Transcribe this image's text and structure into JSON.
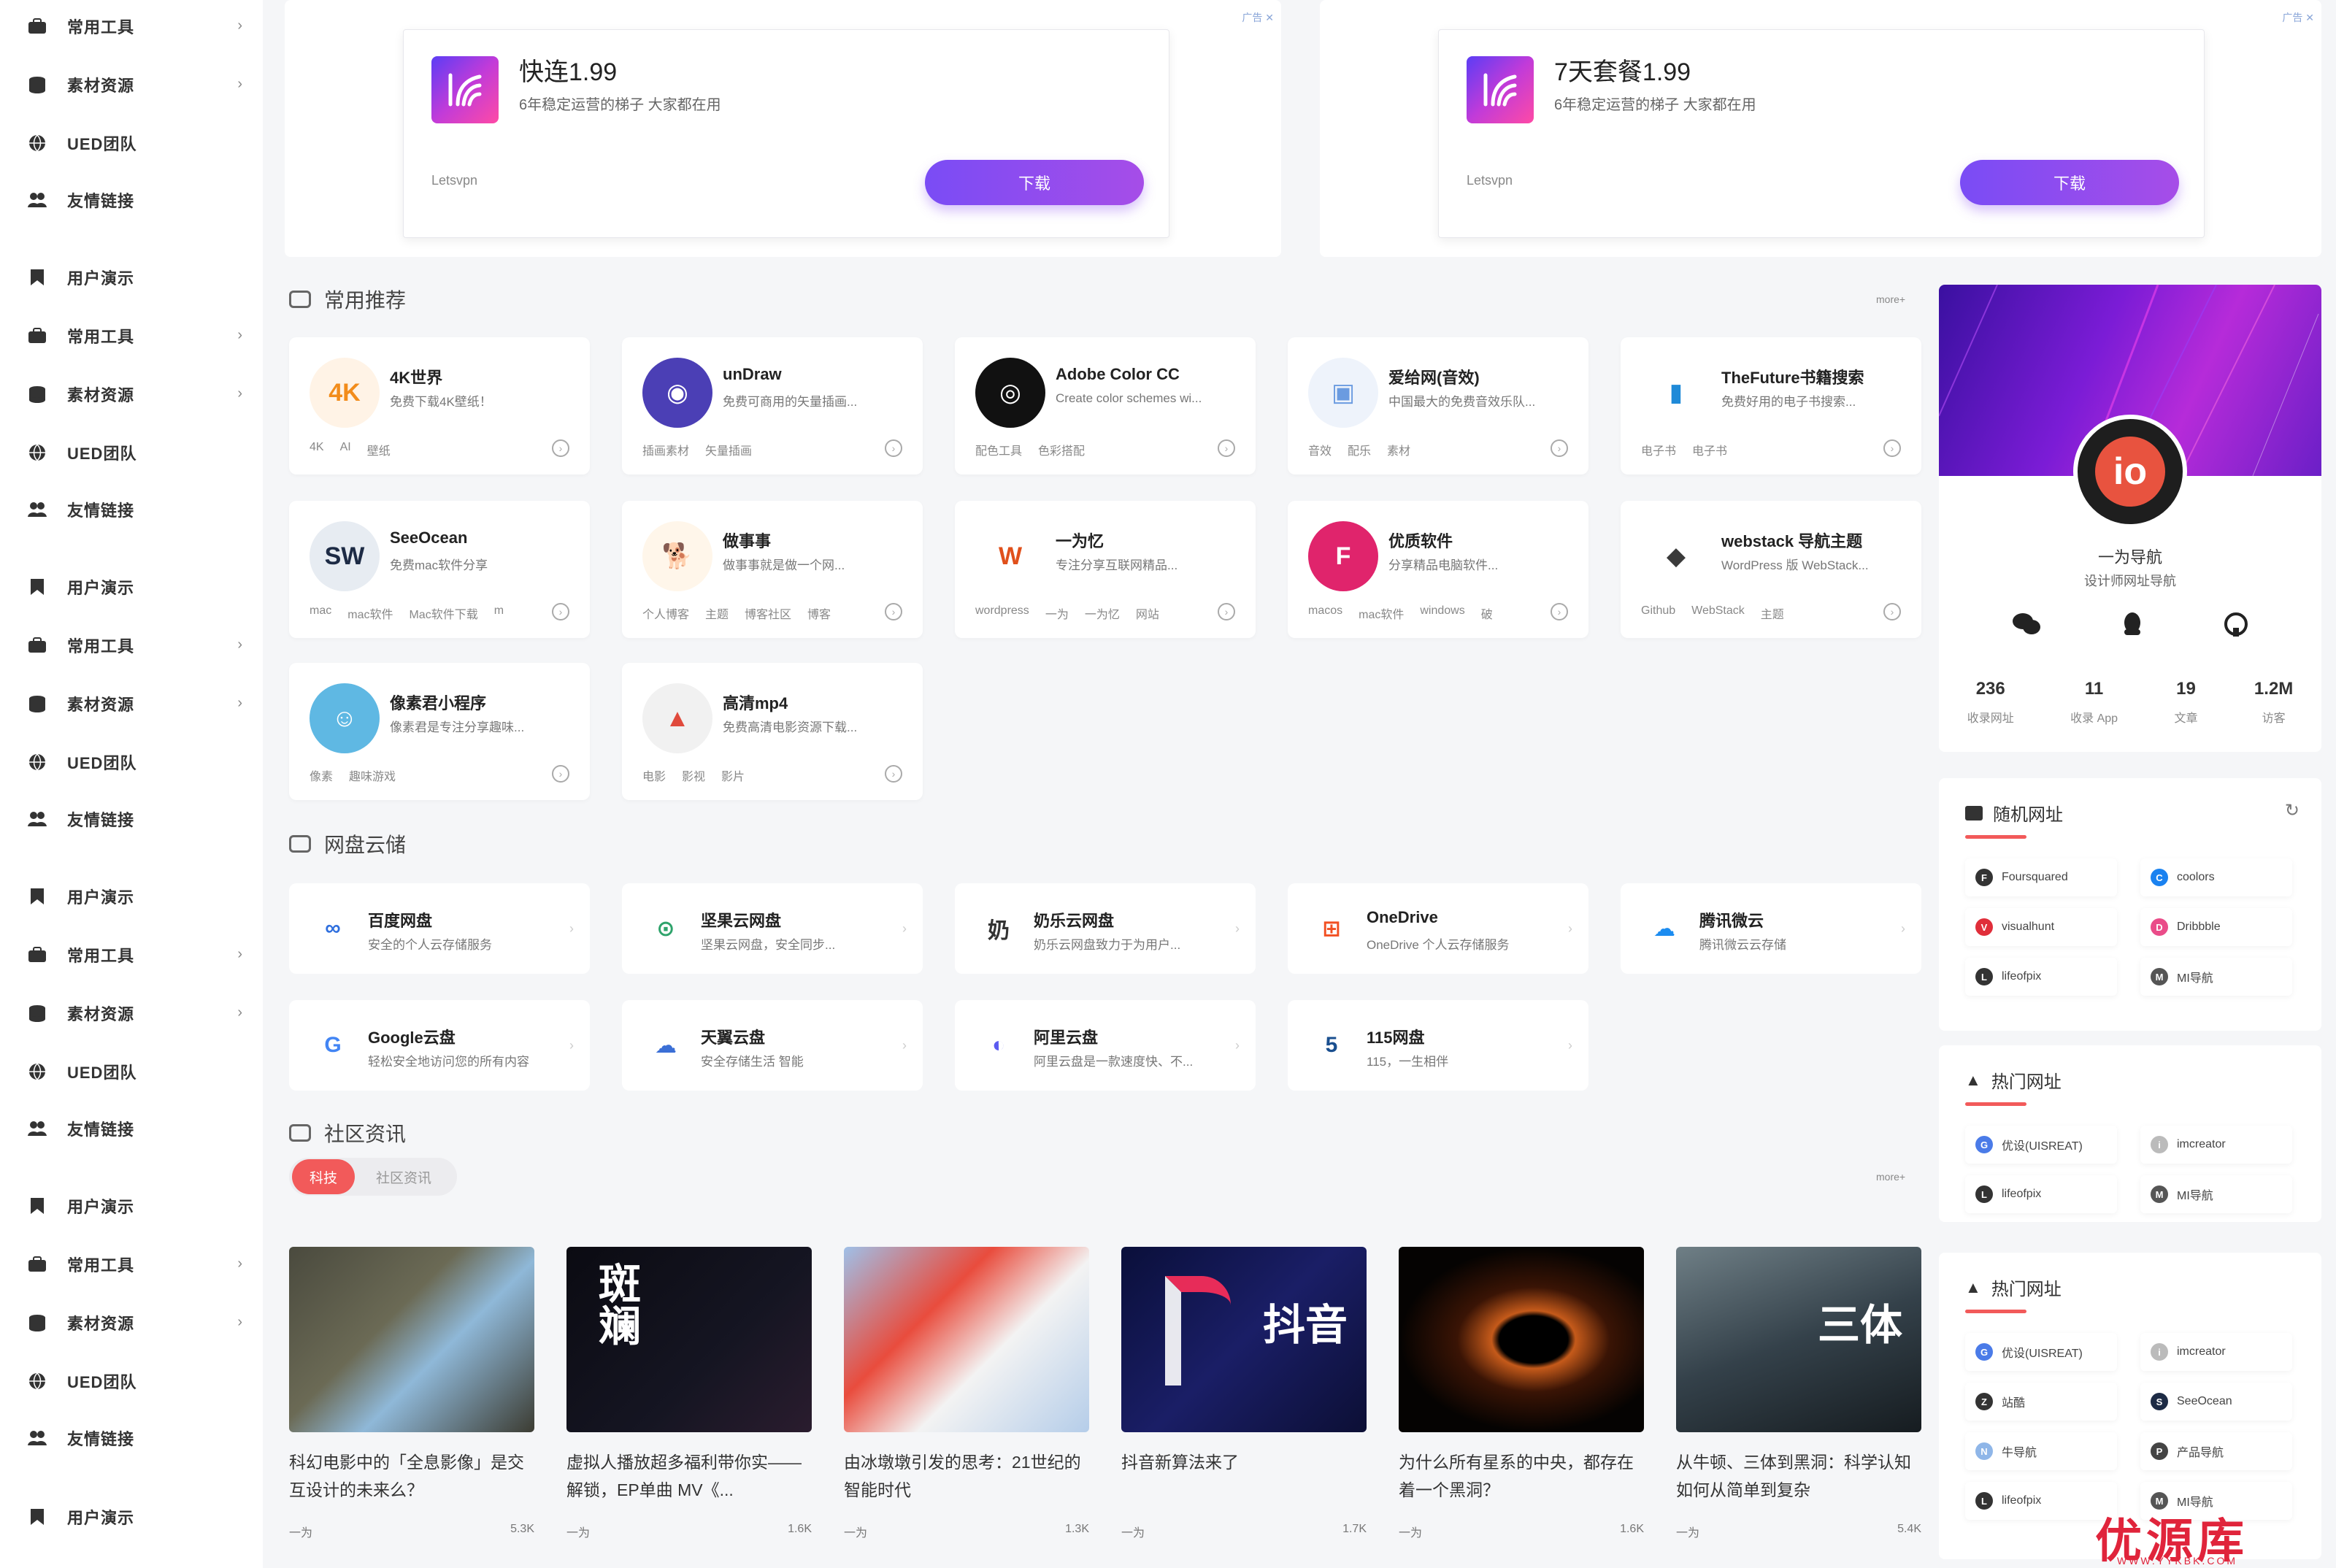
{
  "sidebar": {
    "items": [
      {
        "label": "常用工具",
        "icon": "briefcase-icon",
        "chevron": "›"
      },
      {
        "label": "素材资源",
        "icon": "database-icon",
        "chevron": "›"
      },
      {
        "label": "UED团队",
        "icon": "globe-icon",
        "chevron": ""
      },
      {
        "label": "友情链接",
        "icon": "users-icon",
        "chevron": ""
      },
      {
        "label": "用户演示",
        "icon": "bookmark-icon",
        "chevron": ""
      },
      {
        "label": "常用工具",
        "icon": "briefcase-icon",
        "chevron": "›"
      },
      {
        "label": "素材资源",
        "icon": "database-icon",
        "chevron": "›"
      },
      {
        "label": "UED团队",
        "icon": "globe-icon",
        "chevron": ""
      },
      {
        "label": "友情链接",
        "icon": "users-icon",
        "chevron": ""
      },
      {
        "label": "用户演示",
        "icon": "bookmark-icon",
        "chevron": ""
      },
      {
        "label": "常用工具",
        "icon": "briefcase-icon",
        "chevron": "›"
      },
      {
        "label": "素材资源",
        "icon": "database-icon",
        "chevron": "›"
      },
      {
        "label": "UED团队",
        "icon": "globe-icon",
        "chevron": ""
      },
      {
        "label": "友情链接",
        "icon": "users-icon",
        "chevron": ""
      },
      {
        "label": "用户演示",
        "icon": "bookmark-icon",
        "chevron": ""
      },
      {
        "label": "常用工具",
        "icon": "briefcase-icon",
        "chevron": "›"
      },
      {
        "label": "素材资源",
        "icon": "database-icon",
        "chevron": "›"
      },
      {
        "label": "UED团队",
        "icon": "globe-icon",
        "chevron": ""
      },
      {
        "label": "友情链接",
        "icon": "users-icon",
        "chevron": ""
      },
      {
        "label": "用户演示",
        "icon": "bookmark-icon",
        "chevron": ""
      },
      {
        "label": "常用工具",
        "icon": "briefcase-icon",
        "chevron": "›"
      },
      {
        "label": "素材资源",
        "icon": "database-icon",
        "chevron": "›"
      },
      {
        "label": "UED团队",
        "icon": "globe-icon",
        "chevron": ""
      },
      {
        "label": "友情链接",
        "icon": "users-icon",
        "chevron": ""
      },
      {
        "label": "用户演示",
        "icon": "bookmark-icon",
        "chevron": ""
      }
    ]
  },
  "ads": [
    {
      "title": "快连1.99",
      "desc": "6年稳定运营的梯子 大家都在用",
      "brand": "Letsvpn",
      "button": "下载",
      "mark": "广告 ✕"
    },
    {
      "title": "7天套餐1.99",
      "desc": "6年稳定运营的梯子 大家都在用",
      "brand": "Letsvpn",
      "button": "下载",
      "mark": "广告 ✕"
    }
  ],
  "sections": {
    "recommend": {
      "title": "常用推荐",
      "more": "more+"
    },
    "cloud": {
      "title": "网盘云储"
    },
    "news": {
      "title": "社区资讯",
      "more": "more+"
    }
  },
  "recommend_sites": [
    {
      "name": "4K世界",
      "desc": "免费下载4K壁纸！",
      "tags": [
        "4K",
        "AI",
        "壁纸"
      ],
      "logo_text": "4K",
      "logo_bg": "#fff3e6",
      "logo_color": "#f28c1b"
    },
    {
      "name": "unDraw",
      "desc": "免费可商用的矢量插画...",
      "tags": [
        "插画素材",
        "矢量插画"
      ],
      "logo_text": "◉",
      "logo_bg": "#4b3fb5",
      "logo_color": "#ffffff"
    },
    {
      "name": "Adobe Color CC",
      "desc": "Create color schemes wi...",
      "tags": [
        "配色工具",
        "色彩搭配"
      ],
      "logo_text": "◎",
      "logo_bg": "#111111",
      "logo_color": "#ffffff"
    },
    {
      "name": "爱给网(音效)",
      "desc": "中国最大的免费音效乐队...",
      "tags": [
        "音效",
        "配乐",
        "素材"
      ],
      "logo_text": "▣",
      "logo_bg": "#eef3fb",
      "logo_color": "#6b9be0"
    },
    {
      "name": "TheFuture书籍搜索",
      "desc": "免费好用的电子书搜索...",
      "tags": [
        "电子书",
        "电子书"
      ],
      "logo_text": "▮",
      "logo_bg": "#ffffff",
      "logo_color": "#1f8ad8"
    },
    {
      "name": "SeeOcean",
      "desc": "免费mac软件分享",
      "tags": [
        "mac",
        "mac软件",
        "Mac软件下载",
        "m"
      ],
      "logo_text": "SW",
      "logo_bg": "#e7ecf2",
      "logo_color": "#1d2b45"
    },
    {
      "name": "做事事",
      "desc": "做事事就是做一个网...",
      "tags": [
        "个人博客",
        "主题",
        "博客社区",
        "博客"
      ],
      "logo_text": "🐕",
      "logo_bg": "#fff6ea",
      "logo_color": "#d98a26"
    },
    {
      "name": "一为忆",
      "desc": "专注分享互联网精品...",
      "tags": [
        "wordpress",
        "一为",
        "一为忆",
        "网站"
      ],
      "logo_text": "W",
      "logo_bg": "#ffffff",
      "logo_color": "#e0501b"
    },
    {
      "name": "优质软件",
      "desc": "分享精品电脑软件...",
      "tags": [
        "macos",
        "mac软件",
        "windows",
        "破"
      ],
      "logo_text": "F",
      "logo_bg": "#e0246c",
      "logo_color": "#ffffff"
    },
    {
      "name": "webstack 导航主题",
      "desc": "WordPress 版 WebStack...",
      "tags": [
        "Github",
        "WebStack",
        "主题"
      ],
      "logo_text": "◆",
      "logo_bg": "#ffffff",
      "logo_color": "#3a3a3a"
    },
    {
      "name": "像素君小程序",
      "desc": "像素君是专注分享趣味...",
      "tags": [
        "像素",
        "趣味游戏"
      ],
      "logo_text": "☺",
      "logo_bg": "#5fb8e3",
      "logo_color": "#ffffff"
    },
    {
      "name": "高清mp4",
      "desc": "免费高清电影资源下载...",
      "tags": [
        "电影",
        "影视",
        "影片"
      ],
      "logo_text": "▲",
      "logo_bg": "#f1f1f1",
      "logo_color": "#e04a3c"
    }
  ],
  "cloud_sites": [
    {
      "name": "百度网盘",
      "desc": "安全的个人云存储服务",
      "logo_text": "∞",
      "logo_color": "#2f6fde"
    },
    {
      "name": "坚果云网盘",
      "desc": "坚果云网盘，安全同步...",
      "logo_text": "⊙",
      "logo_color": "#2ea36b"
    },
    {
      "name": "奶乐云网盘",
      "desc": "奶乐云网盘致力于为用户...",
      "logo_text": "奶",
      "logo_color": "#333333"
    },
    {
      "name": "OneDrive",
      "desc": "OneDrive 个人云存储服务",
      "logo_text": "⊞",
      "logo_color": "#f25022"
    },
    {
      "name": "腾讯微云",
      "desc": "腾讯微云云存储",
      "logo_text": "☁",
      "logo_color": "#1c8cf0"
    },
    {
      "name": "Google云盘",
      "desc": "轻松安全地访问您的所有内容",
      "logo_text": "G",
      "logo_color": "#4285f4"
    },
    {
      "name": "天翼云盘",
      "desc": "安全存储生活 智能",
      "logo_text": "☁",
      "logo_color": "#3b6fd6"
    },
    {
      "name": "阿里云盘",
      "desc": "阿里云盘是一款速度快、不...",
      "logo_text": "◐",
      "logo_color": "#5b5bf0"
    },
    {
      "name": "115网盘",
      "desc": "115，一生相伴",
      "logo_text": "5",
      "logo_color": "#1a4f8f"
    }
  ],
  "news_tabs": [
    {
      "label": "科技",
      "active": true
    },
    {
      "label": "社区资讯",
      "active": false
    }
  ],
  "news": [
    {
      "title": "科幻电影中的「全息影像」是交互设计的未来么？",
      "author": "一为",
      "views": "5.3K"
    },
    {
      "title": "虚拟人播放超多福利带你实——解锁，EP单曲 MV《...",
      "author": "一为",
      "views": "1.6K"
    },
    {
      "title": "由冰墩墩引发的思考：21世纪的智能时代",
      "author": "一为",
      "views": "1.3K"
    },
    {
      "title": "抖音新算法来了",
      "author": "一为",
      "views": "1.7K"
    },
    {
      "title": "为什么所有星系的中央，都存在着一个黑洞？",
      "author": "一为",
      "views": "1.6K"
    },
    {
      "title": "从牛顿、三体到黑洞：科学认知如何从简单到复杂",
      "author": "一为",
      "views": "5.4K"
    }
  ],
  "news_images": [
    {
      "label": "",
      "palette": "hologram"
    },
    {
      "label": "斑斓",
      "palette": "dark"
    },
    {
      "label": "",
      "palette": "panda"
    },
    {
      "label": "抖音",
      "palette": "tiktok"
    },
    {
      "label": "",
      "palette": "blackhole"
    },
    {
      "label": "三体",
      "palette": "santi"
    }
  ],
  "profile": {
    "avatar_text": "io",
    "name": "一为导航",
    "sub": "设计师网址导航",
    "icons": [
      "wechat-icon",
      "qq-icon",
      "github-icon"
    ],
    "stats": [
      {
        "n": "236",
        "l": "收录网址"
      },
      {
        "n": "11",
        "l": "收录 App"
      },
      {
        "n": "19",
        "l": "文章"
      },
      {
        "n": "1.2M",
        "l": "访客"
      }
    ]
  },
  "random_links": {
    "title": "随机网址",
    "items": [
      {
        "name": "Foursquared",
        "color": "#333333",
        "ico": "F"
      },
      {
        "name": "coolors",
        "color": "#1a82f0",
        "ico": "C"
      },
      {
        "name": "visualhunt",
        "color": "#e02e3a",
        "ico": "V"
      },
      {
        "name": "Dribbble",
        "color": "#ea4c89",
        "ico": "D"
      },
      {
        "name": "lifeofpix",
        "color": "#333333",
        "ico": "L"
      },
      {
        "name": "MI导航",
        "color": "#555555",
        "ico": "M"
      }
    ]
  },
  "hot_links_1": {
    "title": "热门网址",
    "items": [
      {
        "name": "优设(UISREAT)",
        "color": "#4a7be8",
        "ico": "G"
      },
      {
        "name": "imcreator",
        "color": "#bbbbbb",
        "ico": "i"
      },
      {
        "name": "lifeofpix",
        "color": "#333333",
        "ico": "L"
      },
      {
        "name": "MI导航",
        "color": "#555555",
        "ico": "M"
      }
    ]
  },
  "hot_links_2": {
    "title": "热门网址",
    "items": [
      {
        "name": "优设(UISREAT)",
        "color": "#4a7be8",
        "ico": "G"
      },
      {
        "name": "imcreator",
        "color": "#bbbbbb",
        "ico": "i"
      },
      {
        "name": "站酷",
        "color": "#333333",
        "ico": "Z"
      },
      {
        "name": "SeeOcean",
        "color": "#1d2b45",
        "ico": "S"
      },
      {
        "name": "牛导航",
        "color": "#8fb6e8",
        "ico": "N"
      },
      {
        "name": "产品导航",
        "color": "#444444",
        "ico": "P"
      },
      {
        "name": "lifeofpix",
        "color": "#333333",
        "ico": "L"
      },
      {
        "name": "MI导航",
        "color": "#555555",
        "ico": "M"
      }
    ]
  },
  "watermark": {
    "text": "优源库",
    "url": "WWW.YYKBK.COM"
  },
  "colors": {
    "accent": "#8a4cf0",
    "red": "#f25a5a",
    "bg": "#f5f6f8"
  }
}
